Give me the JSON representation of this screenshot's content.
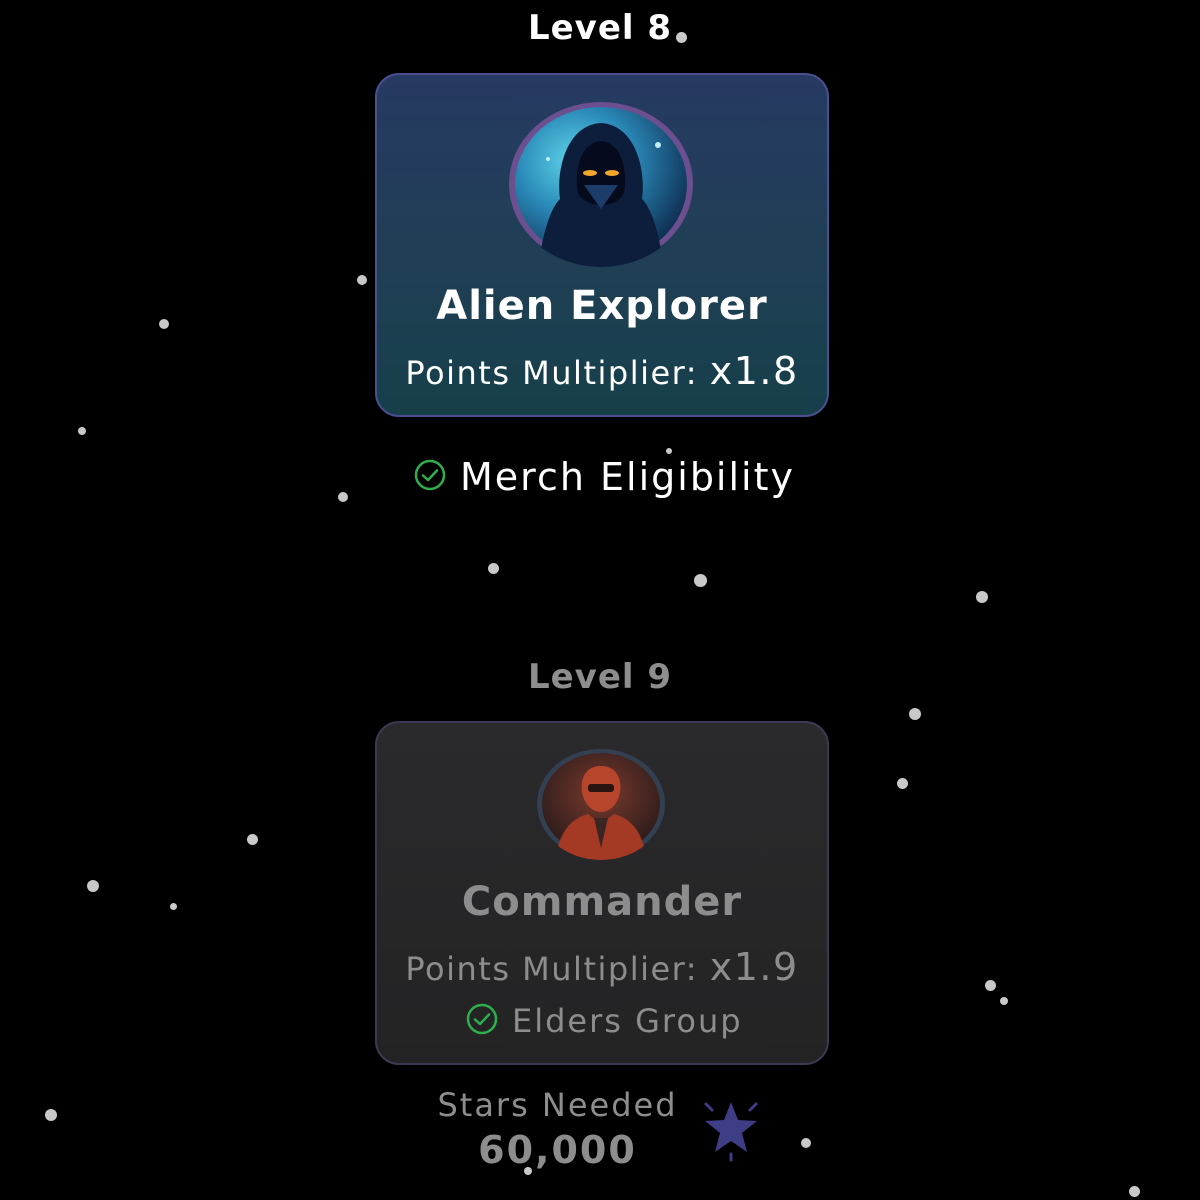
{
  "levels": [
    {
      "title": "Level 8",
      "name": "Alien Explorer",
      "multiplier_label": "Points Multiplier:",
      "multiplier_value": "x1.8",
      "perk": "Merch Eligibility",
      "status": "unlocked"
    },
    {
      "title": "Level 9",
      "name": "Commander",
      "multiplier_label": "Points Multiplier:",
      "multiplier_value": "x1.9",
      "perk": "Elders Group",
      "status": "locked",
      "stars_needed_label": "Stars Needed",
      "stars_needed_value": "60,000"
    }
  ],
  "icons": {
    "check": "check-circle-icon",
    "star": "star-icon"
  },
  "colors": {
    "background": "#000000",
    "check_green": "#2fae4e",
    "star_purple": "#3f3d86",
    "locked_text": "#8d8d8d"
  }
}
